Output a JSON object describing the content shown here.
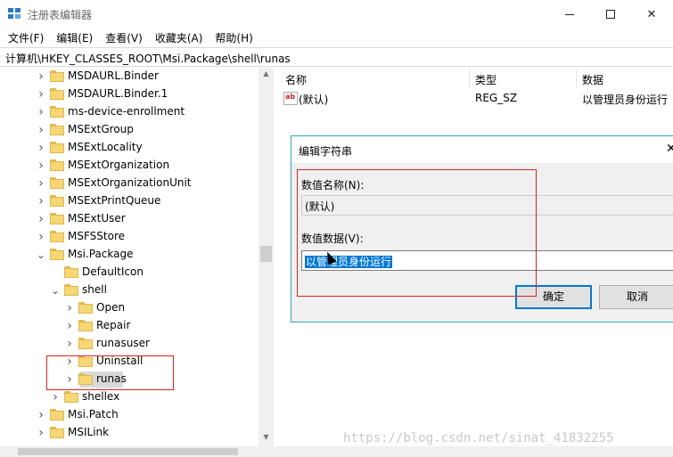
{
  "window": {
    "title": "注册表编辑器",
    "controls": {
      "minimize": "minimize-icon",
      "maximize": "maximize-icon",
      "close": "close-icon"
    }
  },
  "menu": [
    "文件(F)",
    "编辑(E)",
    "查看(V)",
    "收藏夹(A)",
    "帮助(H)"
  ],
  "address": "计算机\\HKEY_CLASSES_ROOT\\Msi.Package\\shell\\runas",
  "tree": [
    {
      "label": "MSDAURL.Binder",
      "depth": 0,
      "chevron": "›"
    },
    {
      "label": "MSDAURL.Binder.1",
      "depth": 0,
      "chevron": "›"
    },
    {
      "label": "ms-device-enrollment",
      "depth": 0,
      "chevron": "›"
    },
    {
      "label": "MSExtGroup",
      "depth": 0,
      "chevron": "›"
    },
    {
      "label": "MSExtLocality",
      "depth": 0,
      "chevron": "›"
    },
    {
      "label": "MSExtOrganization",
      "depth": 0,
      "chevron": "›"
    },
    {
      "label": "MSExtOrganizationUnit",
      "depth": 0,
      "chevron": "›"
    },
    {
      "label": "MSExtPrintQueue",
      "depth": 0,
      "chevron": "›"
    },
    {
      "label": "MSExtUser",
      "depth": 0,
      "chevron": "›"
    },
    {
      "label": "MSFSStore",
      "depth": 0,
      "chevron": "›"
    },
    {
      "label": "Msi.Package",
      "depth": 0,
      "chevron": "⌄"
    },
    {
      "label": "DefaultIcon",
      "depth": 1,
      "chevron": ""
    },
    {
      "label": "shell",
      "depth": 1,
      "chevron": "⌄"
    },
    {
      "label": "Open",
      "depth": 2,
      "chevron": "›"
    },
    {
      "label": "Repair",
      "depth": 2,
      "chevron": "›"
    },
    {
      "label": "runasuser",
      "depth": 2,
      "chevron": "›"
    },
    {
      "label": "Uninstall",
      "depth": 2,
      "chevron": "›"
    },
    {
      "label": "runas",
      "depth": 2,
      "chevron": "›",
      "selected": true
    },
    {
      "label": "shellex",
      "depth": 1,
      "chevron": "›"
    },
    {
      "label": "Msi.Patch",
      "depth": 0,
      "chevron": "›"
    },
    {
      "label": "MSILink",
      "depth": 0,
      "chevron": "›"
    }
  ],
  "list": {
    "headers": {
      "name": "名称",
      "type": "类型",
      "data": "数据"
    },
    "rows": [
      {
        "icon": "ab-string-icon",
        "name": "(默认)",
        "type": "REG_SZ",
        "data": "以管理员身份运行"
      }
    ]
  },
  "dialog": {
    "title": "编辑字符串",
    "name_label": "数值名称(N):",
    "name_value": "(默认)",
    "data_label": "数值数据(V):",
    "data_value": "以管理员身份运行",
    "ok": "确定",
    "cancel": "取消"
  },
  "watermark": "https://blog.csdn.net/sinat_41832255",
  "colors": {
    "accent": "#0078d7",
    "annotation": "#e02020",
    "folder": "#f7d774"
  }
}
